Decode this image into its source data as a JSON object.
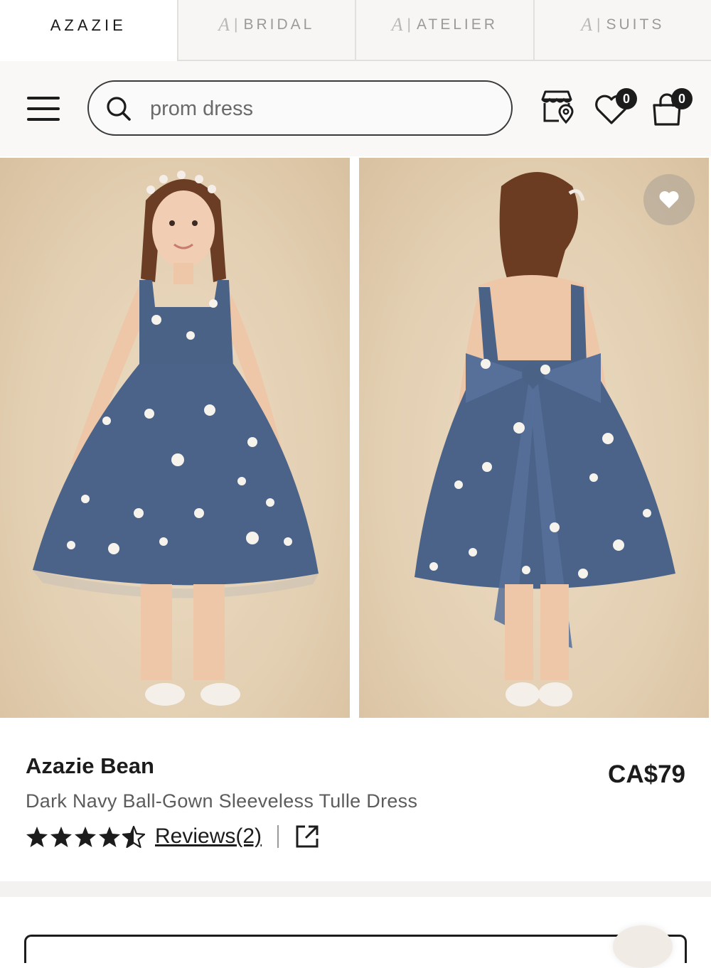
{
  "brand_tabs": [
    {
      "label": "AZAZIE",
      "active": true
    },
    {
      "label": "BRIDAL",
      "active": false
    },
    {
      "label": "ATELIER",
      "active": false
    },
    {
      "label": "SUITS",
      "active": false
    }
  ],
  "search": {
    "value": "prom dress",
    "placeholder": "prom dress"
  },
  "header": {
    "wishlist_count": "0",
    "cart_count": "0"
  },
  "product": {
    "name": "Azazie Bean",
    "price": "CA$79",
    "description": "Dark Navy Ball-Gown Sleeveless Tulle Dress",
    "rating": 4.5,
    "reviews_label": "Reviews(2)"
  },
  "colors": {
    "dress": "#4a6286",
    "background": "#e8d6bc",
    "text": "#1c1c1c"
  }
}
